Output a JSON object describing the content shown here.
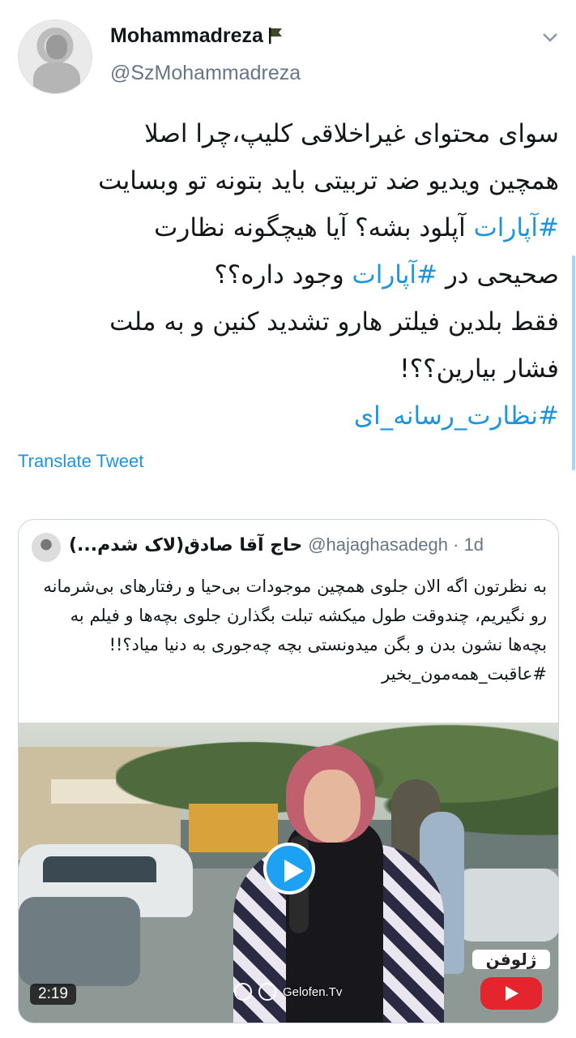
{
  "tweet": {
    "display_name": "Mohammadreza",
    "handle": "@SzMohammadreza",
    "text_lines": [
      {
        "text": "سوای محتوای غیراخلاقی کلیپ،چرا اصلا"
      },
      {
        "text": "همچین ویدیو ضد تربیتی باید بتونه تو وبسایت"
      },
      {
        "hashtag": "#آپارات",
        "text": " آپلود بشه؟ آیا هیچگونه نظارت"
      },
      {
        "text_before": "صحیحی در ",
        "hashtag": "#آپارات",
        "text": " وجود داره؟؟"
      },
      {
        "text": "فقط بلدین فیلتر هارو تشدید کنین و به ملت"
      },
      {
        "text": "فشار بیارین؟؟!"
      },
      {
        "hashtag": "#نظارت_رسانه_ای"
      }
    ],
    "translate_label": "Translate Tweet",
    "colors": {
      "link": "#1b95e0",
      "text": "#14171a",
      "secondary": "#657786"
    }
  },
  "quoted": {
    "name": "حاج آقا صادق(لاک شدم...)",
    "handle_time": "@hajaghasadegh · 1d",
    "text": "به نظرتون اگه الان جلوی همچین موجودات بی‌حیا و رفتارهای بی‌شرمانه رو نگیریم، چندوقت طول میکشه تبلت بگذارن جلوی بچه‌ها و فیلم به بچه‌ها نشون بدن و بگن میدونستی بچه چه‌جوری به دنیا میاد؟!!",
    "hashtag": "#عاقبت_همه‌مون_بخیر",
    "media": {
      "duration": "2:19",
      "watermark": "Gelofen.Tv",
      "logo_text": "ژلوفن"
    }
  }
}
